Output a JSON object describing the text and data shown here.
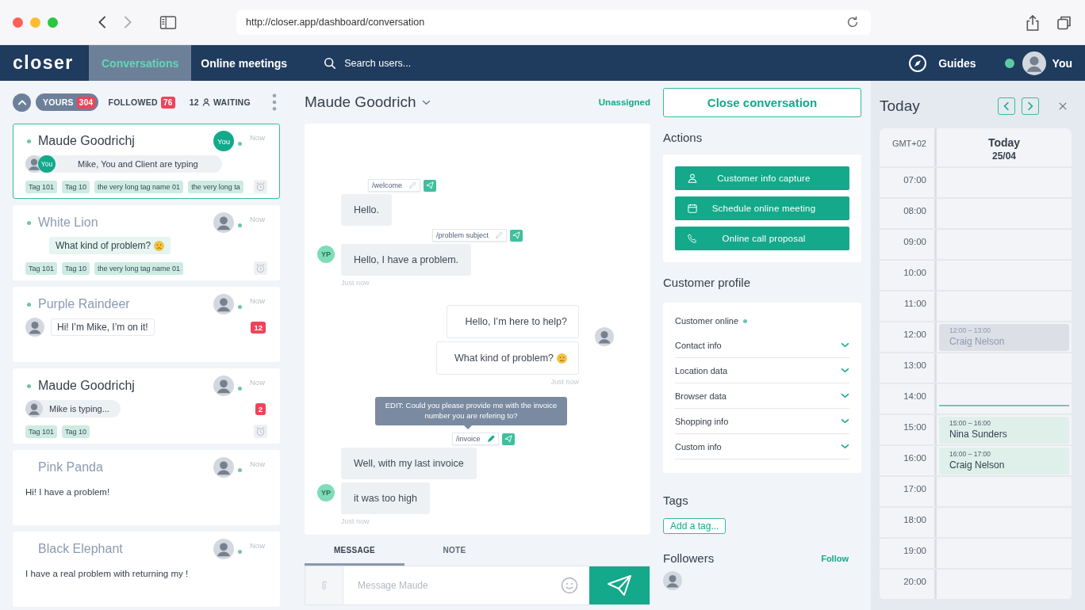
{
  "browser": {
    "url": "http://closer.app/dashboard/conversation"
  },
  "nav": {
    "logo": "closer",
    "tabs": [
      {
        "label": "Conversations",
        "selected": true
      },
      {
        "label": "Online meetings",
        "selected": false
      }
    ],
    "search": {
      "placeholder": "Search users..."
    },
    "guides": "Guides",
    "user": {
      "name": "You",
      "online": true
    }
  },
  "inbox": {
    "filters": [
      {
        "kind": "count",
        "label": "YOURS",
        "count": "304",
        "selected": true
      },
      {
        "kind": "count",
        "label": "FOLLOWED",
        "count": "76",
        "selected": false
      },
      {
        "kind": "waiting",
        "count": "12",
        "label": "WAITING",
        "selected": false
      }
    ]
  },
  "conversations": [
    {
      "name": "Maude Goodrichj",
      "unread": true,
      "online": true,
      "selected": true,
      "assignee": {
        "kind": "you",
        "label": "You"
      },
      "time": "Now",
      "preview": {
        "kind": "typing",
        "you_label": "You",
        "text": "Mike, You and Client are typing"
      },
      "tags": [
        "Tag 101",
        "Tag 10",
        "the very long tag name 01",
        "the very long ta"
      ],
      "reminder": true
    },
    {
      "name": "White Lion",
      "unread": false,
      "online": true,
      "selected": false,
      "assignee": {
        "kind": "photo"
      },
      "time": "Now",
      "preview": {
        "kind": "customer",
        "text": "What kind of problem?",
        "emoji": true
      },
      "tags": [
        "Tag 101",
        "Tag 10",
        "the very long tag name 01"
      ],
      "reminder": true
    },
    {
      "name": "Purple Raindeer",
      "unread": false,
      "online": true,
      "selected": false,
      "assignee": {
        "kind": "photo"
      },
      "time": "Now",
      "preview": {
        "kind": "agent",
        "text": "Hi! I’m Mike, I’m on it!"
      },
      "unread_count": "12",
      "reminder": false
    },
    {
      "name": "Maude Goodrichj",
      "unread": true,
      "online": true,
      "selected": false,
      "assignee": {
        "kind": "photo"
      },
      "time": "Now",
      "preview": {
        "kind": "typing",
        "text": "Mike is typing..."
      },
      "unread_count": "2",
      "tags": [
        "Tag 101",
        "Tag 10"
      ],
      "reminder": true
    },
    {
      "name": "Pink Panda",
      "unread": false,
      "online": false,
      "selected": false,
      "assignee": {
        "kind": "photo"
      },
      "time": "Now",
      "preview": {
        "kind": "plain",
        "text": "Hi! I have a problem!"
      },
      "reminder": false
    },
    {
      "name": "Black Elephant",
      "unread": false,
      "online": false,
      "selected": false,
      "assignee": {
        "kind": "photo"
      },
      "time": "Now",
      "preview": {
        "kind": "plain",
        "text": "I have a real problem with returning my !"
      },
      "reminder": false
    }
  ],
  "chat": {
    "contact": "Maude Goodrich",
    "assignment": "Unassigned",
    "groups": [
      {
        "kind": "customer",
        "initials": "YP",
        "time": "Just now",
        "messages": [
          {
            "text": "Hello.",
            "command": {
              "label": "/welcome",
              "editing": false
            }
          },
          {
            "text": "Hello, I have a problem.",
            "command": {
              "label": "/problem subject",
              "editing": false
            }
          }
        ]
      },
      {
        "kind": "agent",
        "time": "Just now",
        "messages": [
          {
            "text": "Hello, I’m here to help?",
            "emoji": false
          },
          {
            "text": "What kind of problem?",
            "emoji": true
          }
        ]
      },
      {
        "kind": "customer",
        "initials": "YP",
        "time": "Just now",
        "messages": [
          {
            "text": "Well, with my last invoice",
            "command": {
              "label": "/invoice",
              "editing": true,
              "tooltip": "EDIT: Could you please provide me with the invoice number you are refering to?"
            }
          },
          {
            "text": "it was too high"
          }
        ]
      }
    ]
  },
  "composer": {
    "tabs": [
      {
        "label": "MESSAGE",
        "selected": true
      },
      {
        "label": "NOTE",
        "selected": false
      }
    ],
    "placeholder": "Message Maude"
  },
  "details": {
    "close": "Close conversation",
    "actions_title": "Actions",
    "actions": [
      {
        "kind": "person",
        "label": "Customer info capture"
      },
      {
        "kind": "calendar",
        "label": "Schedule online meeting"
      },
      {
        "kind": "phone",
        "label": "Online call proposal"
      }
    ],
    "profile_title": "Customer profile",
    "online_label": "Customer online",
    "customer_online": true,
    "sections": [
      {
        "label": "Contact info",
        "expanded": false
      },
      {
        "label": "Location data",
        "expanded": false
      },
      {
        "label": "Browser data",
        "expanded": false
      },
      {
        "label": "Shopping info",
        "expanded": false
      },
      {
        "label": "Custom info",
        "expanded": false
      }
    ],
    "tags_title": "Tags",
    "add_tag": "Add a tag...",
    "followers_title": "Followers",
    "follow": "Follow"
  },
  "calendar": {
    "title": "Today",
    "timezone": "GMT+02",
    "day": "Today",
    "date": "25/04",
    "hours": [
      {
        "label": "07:00",
        "current_time": false
      },
      {
        "label": "08:00",
        "current_time": false
      },
      {
        "label": "09:00",
        "current_time": false
      },
      {
        "label": "10:00",
        "current_time": false
      },
      {
        "label": "11:00",
        "current_time": false
      },
      {
        "label": "12:00",
        "current_time": false,
        "events": [
          {
            "time": "12:00 – 13:00",
            "name": "Craig Nelson",
            "past": true
          }
        ]
      },
      {
        "label": "13:00",
        "current_time": false
      },
      {
        "label": "14:00",
        "current_time": true
      },
      {
        "label": "15:00",
        "current_time": false,
        "events": [
          {
            "time": "15:00 – 16:00",
            "name": "Nina Sunders",
            "past": false
          }
        ]
      },
      {
        "label": "16:00",
        "current_time": false,
        "events": [
          {
            "time": "16:00 – 17:00",
            "name": "Craig Nelson",
            "past": false
          }
        ]
      },
      {
        "label": "17:00",
        "current_time": false
      },
      {
        "label": "18:00",
        "current_time": false
      },
      {
        "label": "19:00",
        "current_time": false
      },
      {
        "label": "20:00",
        "current_time": false
      }
    ]
  }
}
